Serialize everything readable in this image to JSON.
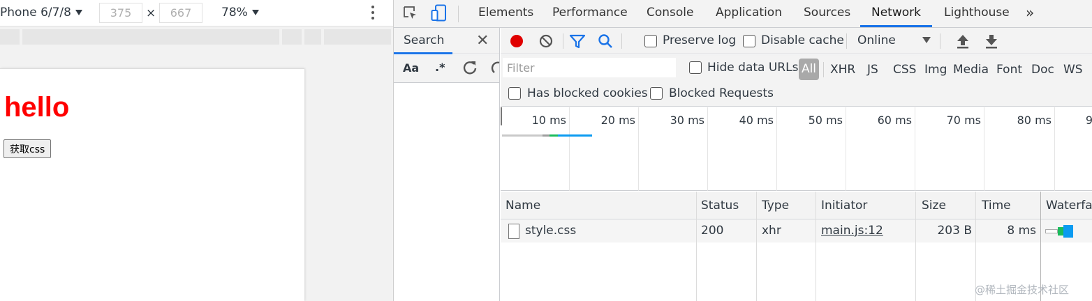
{
  "emulation": {
    "device": "Phone 6/7/8",
    "width": "375",
    "times": "×",
    "height": "667",
    "zoom": "78%"
  },
  "page": {
    "heading": "hello",
    "button_label": "获取css"
  },
  "devtools": {
    "tabs": [
      "Elements",
      "Performance",
      "Console",
      "Application",
      "Sources",
      "Network",
      "Lighthouse",
      "»"
    ],
    "active_tab": "Network"
  },
  "search_panel": {
    "title": "Search",
    "close": "✕",
    "match_case": "Aa",
    "regex": ".*"
  },
  "network": {
    "preserve_log": "Preserve log",
    "disable_cache": "Disable cache",
    "throttling": "Online",
    "filter_placeholder": "Filter",
    "hide_data_urls": "Hide data URLs",
    "types": [
      "All",
      "XHR",
      "JS",
      "CSS",
      "Img",
      "Media",
      "Font",
      "Doc",
      "WS"
    ],
    "active_type": "All",
    "has_blocked_cookies": "Has blocked cookies",
    "blocked_requests": "Blocked Requests",
    "timeline_ticks": [
      "10 ms",
      "20 ms",
      "30 ms",
      "40 ms",
      "50 ms",
      "60 ms",
      "70 ms",
      "80 ms",
      "9"
    ],
    "columns": [
      "Name",
      "Status",
      "Type",
      "Initiator",
      "Size",
      "Time",
      "Waterfall"
    ],
    "rows": [
      {
        "name": "style.css",
        "status": "200",
        "type": "xhr",
        "initiator": "main.js:12",
        "size": "203 B",
        "time": "8 ms"
      }
    ]
  },
  "colors": {
    "accent": "#1a73e8",
    "record": "#e00000",
    "heading": "#ff0000",
    "waterfall_wait": "#1bbc5c",
    "waterfall_download": "#0b9bf1"
  },
  "watermark": "@稀土掘金技术社区"
}
